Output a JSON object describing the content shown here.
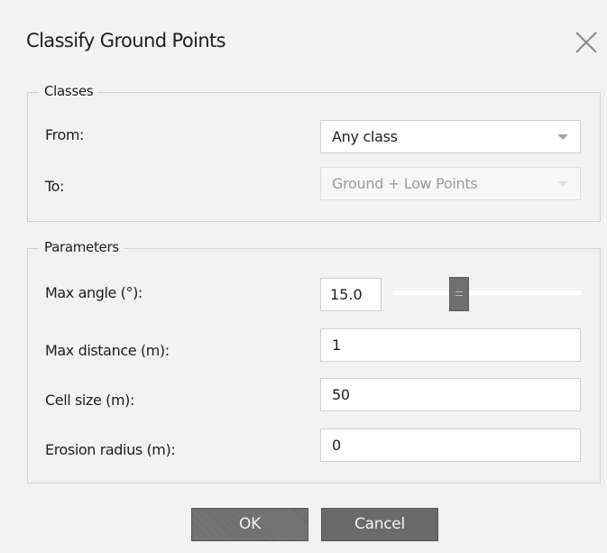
{
  "dialog": {
    "title": "Classify Ground Points",
    "close_icon": "close-icon"
  },
  "classes": {
    "legend": "Classes",
    "from_label": "From:",
    "from_value": "Any class",
    "to_label": "To:",
    "to_value": "Ground + Low Points",
    "dropdown_icon": "chevron-down-icon"
  },
  "parameters": {
    "legend": "Parameters",
    "max_angle_label": "Max angle (°):",
    "max_angle_value": "15.0",
    "max_distance_label": "Max distance (m):",
    "max_distance_value": "1",
    "cell_size_label": "Cell size (m):",
    "cell_size_value": "50",
    "erosion_radius_label": "Erosion radius (m):",
    "erosion_radius_value": "0"
  },
  "slider": {
    "min": 0,
    "max": 45,
    "value": 15.0
  },
  "buttons": {
    "ok_label": "OK",
    "cancel_label": "Cancel"
  }
}
